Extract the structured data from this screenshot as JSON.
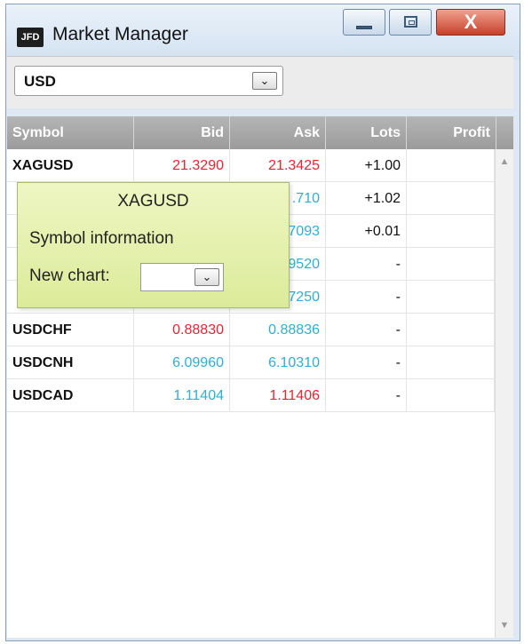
{
  "window": {
    "title": "Market Manager",
    "logo_text": "JFD",
    "minimize_icon": "minimize-icon",
    "maximize_icon": "maximize-icon",
    "close_icon": "close-icon",
    "close_glyph": "X"
  },
  "toolbar": {
    "currency_value": "USD",
    "dropdown_glyph": "⌄"
  },
  "table": {
    "columns": [
      "Symbol",
      "Bid",
      "Ask",
      "Lots",
      "Profit"
    ],
    "rows": [
      {
        "symbol": "XAGUSD",
        "bid": "21.3290",
        "ask": "21.3425",
        "lots": "+1.00",
        "profit": "",
        "bid_color": "red",
        "ask_color": "red"
      },
      {
        "symbol": "",
        "bid": "",
        "ask": ".710",
        "lots": "+1.02",
        "profit": "",
        "bid_color": "blue",
        "ask_color": "blue"
      },
      {
        "symbol": "",
        "bid": "",
        "ask": "7093",
        "lots": "+0.01",
        "profit": "",
        "bid_color": "blue",
        "ask_color": "blue"
      },
      {
        "symbol": "",
        "bid": "",
        "ask": "9520",
        "lots": "-",
        "profit": "",
        "bid_color": "blue",
        "ask_color": "blue"
      },
      {
        "symbol": "",
        "bid": "",
        "ask": "7250",
        "lots": "-",
        "profit": "",
        "bid_color": "blue",
        "ask_color": "blue"
      },
      {
        "symbol": "USDCHF",
        "bid": "0.88830",
        "ask": "0.88836",
        "lots": "-",
        "profit": "",
        "bid_color": "red",
        "ask_color": "blue"
      },
      {
        "symbol": "USDCNH",
        "bid": "6.09960",
        "ask": "6.10310",
        "lots": "-",
        "profit": "",
        "bid_color": "blue",
        "ask_color": "blue"
      },
      {
        "symbol": "USDCAD",
        "bid": "1.11404",
        "ask": "1.11406",
        "lots": "-",
        "profit": "",
        "bid_color": "blue",
        "ask_color": "red"
      }
    ]
  },
  "popup": {
    "title": "XAGUSD",
    "symbol_info": "Symbol information",
    "new_chart_label": "New chart:",
    "new_chart_value": ""
  },
  "scrollbar": {
    "up_glyph": "▲",
    "down_glyph": "▼"
  },
  "colors": {
    "red": "#f02030",
    "blue": "#2ab0d8",
    "header": "#a8a8a8",
    "popup": "#e4efaa"
  }
}
